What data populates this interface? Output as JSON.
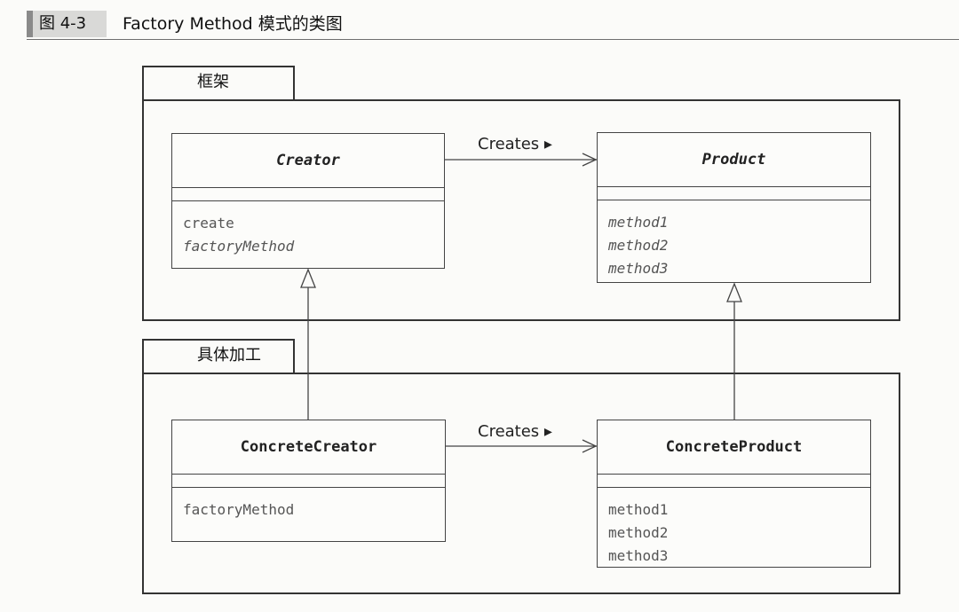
{
  "figure": {
    "tag": "图 4-3",
    "title": "Factory Method 模式的类图"
  },
  "packages": {
    "framework": {
      "name": "框架"
    },
    "concrete": {
      "name": "具体加工"
    }
  },
  "classes": {
    "creator": {
      "name": "Creator",
      "abstract": true,
      "methods": [
        "create",
        "factoryMethod"
      ],
      "abstract_methods": [
        "factoryMethod"
      ]
    },
    "product": {
      "name": "Product",
      "abstract": true,
      "methods": [
        "method1",
        "method2",
        "method3"
      ]
    },
    "concrete_creator": {
      "name": "ConcreteCreator",
      "methods": [
        "factoryMethod"
      ]
    },
    "concrete_product": {
      "name": "ConcreteProduct",
      "methods": [
        "method1",
        "method2",
        "method3"
      ]
    }
  },
  "relations": {
    "top_creates": "Creates ▸",
    "bottom_creates": "Creates ▸"
  }
}
